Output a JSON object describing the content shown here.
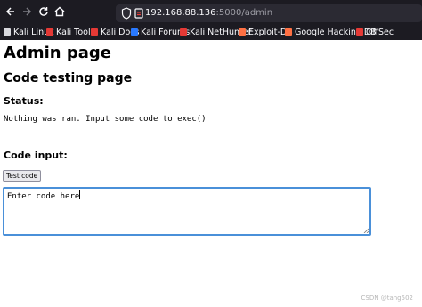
{
  "browser": {
    "nav": {
      "back_icon": "arrow-left-icon",
      "forward_icon": "arrow-right-icon",
      "reload_icon": "reload-icon",
      "home_icon": "home-icon"
    },
    "url": {
      "host": "192.168.88.136",
      "path": ":5000/admin"
    },
    "bookmarks": [
      {
        "label": "Kali Linux",
        "color": "#d9d9de"
      },
      {
        "label": "Kali Tools",
        "color": "#e53935"
      },
      {
        "label": "Kali Docs",
        "color": "#e53935"
      },
      {
        "label": "Kali Forums",
        "color": "#2979ff"
      },
      {
        "label": "Kali NetHunter",
        "color": "#e53935"
      },
      {
        "label": "Exploit-DB",
        "color": "#ff7043"
      },
      {
        "label": "Google Hacking DB",
        "color": "#ff7043"
      },
      {
        "label": "OffSec",
        "color": "#e53935"
      }
    ]
  },
  "page": {
    "title": "Admin page",
    "subtitle": "Code testing page",
    "status_heading": "Status:",
    "status_text": "Nothing was ran. Input some code to exec()",
    "input_heading": "Code input:",
    "test_button": "Test code",
    "textarea_value": "Enter code here"
  },
  "watermark": "CSDN @tang502"
}
